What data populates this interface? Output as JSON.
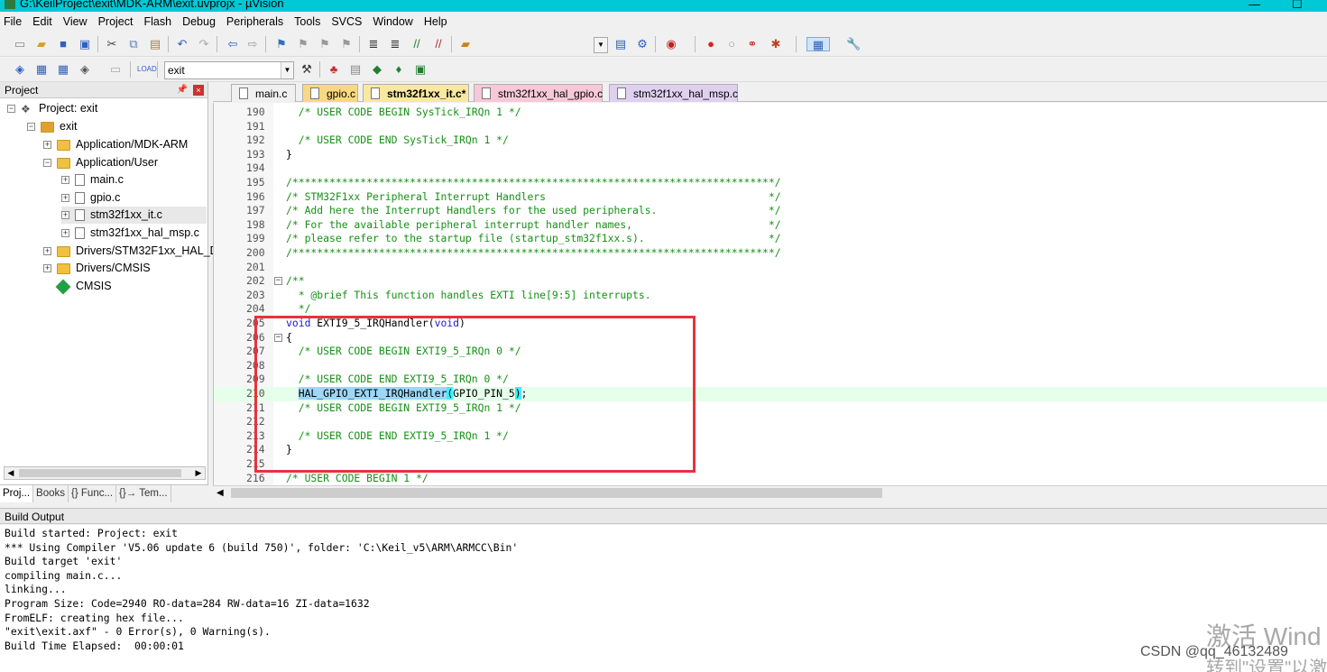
{
  "window": {
    "title": "G:\\KeilProject\\exit\\MDK-ARM\\exit.uvprojx - µVision"
  },
  "menu": [
    "File",
    "Edit",
    "View",
    "Project",
    "Flash",
    "Debug",
    "Peripherals",
    "Tools",
    "SVCS",
    "Window",
    "Help"
  ],
  "toolbar": {
    "target": "exit"
  },
  "project_panel": {
    "title": "Project",
    "tree": {
      "root": "Project: exit",
      "target": "exit",
      "group_mdk": "Application/MDK-ARM",
      "group_user": "Application/User",
      "file_main": "main.c",
      "file_gpio": "gpio.c",
      "file_it": "stm32f1xx_it.c",
      "file_msp": "stm32f1xx_hal_msp.c",
      "group_drivers_hal": "Drivers/STM32F1xx_HAL_Dr",
      "group_drivers_cmsis": "Drivers/CMSIS",
      "cmsis": "CMSIS"
    },
    "tabs": [
      "Proj...",
      "Books",
      "{} Func...",
      "{}→ Tem..."
    ]
  },
  "editor": {
    "tabs": [
      "main.c",
      "gpio.c",
      "stm32f1xx_it.c*",
      "stm32f1xx_hal_gpio.c",
      "stm32f1xx_hal_msp.c"
    ],
    "active_tab": "stm32f1xx_it.c*",
    "tab_colors": [
      "#f0f0f0",
      "#f8d880",
      "#f8e8a0",
      "#f8c8d8",
      "#e0d0f0"
    ],
    "lines": [
      {
        "n": "190",
        "t": "  /* USER CODE BEGIN SysTick_IRQn 1 */"
      },
      {
        "n": "191",
        "t": ""
      },
      {
        "n": "192",
        "t": "  /* USER CODE END SysTick_IRQn 1 */"
      },
      {
        "n": "193",
        "t": "}"
      },
      {
        "n": "194",
        "t": ""
      },
      {
        "n": "195",
        "t": "/******************************************************************************/"
      },
      {
        "n": "196",
        "t": "/* STM32F1xx Peripheral Interrupt Handlers                                    */"
      },
      {
        "n": "197",
        "t": "/* Add here the Interrupt Handlers for the used peripherals.                  */"
      },
      {
        "n": "198",
        "t": "/* For the available peripheral interrupt handler names,                      */"
      },
      {
        "n": "199",
        "t": "/* please refer to the startup file (startup_stm32f1xx.s).                    */"
      },
      {
        "n": "200",
        "t": "/******************************************************************************/"
      },
      {
        "n": "201",
        "t": ""
      },
      {
        "n": "202",
        "t": "/**"
      },
      {
        "n": "203",
        "t": "  * @brief This function handles EXTI line[9:5] interrupts."
      },
      {
        "n": "204",
        "t": "  */"
      },
      {
        "n": "205",
        "t": "void EXTI9_5_IRQHandler(void)"
      },
      {
        "n": "206",
        "t": "{"
      },
      {
        "n": "207",
        "t": "  /* USER CODE BEGIN EXTI9_5_IRQn 0 */"
      },
      {
        "n": "208",
        "t": ""
      },
      {
        "n": "209",
        "t": "  /* USER CODE END EXTI9_5_IRQn 0 */"
      },
      {
        "n": "210",
        "t": "  HAL_GPIO_EXTI_IRQHandler(GPIO_PIN_5);"
      },
      {
        "n": "211",
        "t": "  /* USER CODE BEGIN EXTI9_5_IRQn 1 */"
      },
      {
        "n": "212",
        "t": ""
      },
      {
        "n": "213",
        "t": "  /* USER CODE END EXTI9_5_IRQn 1 */"
      },
      {
        "n": "214",
        "t": "}"
      },
      {
        "n": "215",
        "t": ""
      },
      {
        "n": "216",
        "t": "/* USER CODE BEGIN 1 */"
      }
    ],
    "line210": {
      "sel": "HAL_GPIO_EXTI_IRQHandler",
      "p1": "(",
      "arg": "GPIO_PIN_5",
      "p2": ")",
      "end": ";"
    },
    "line205": {
      "kw": "void",
      "name": " EXTI9_5_IRQHandler(",
      "kw2": "void",
      "close": ")"
    }
  },
  "build_output": {
    "title": "Build Output",
    "lines": [
      "Build started: Project: exit",
      "*** Using Compiler 'V5.06 update 6 (build 750)', folder: 'C:\\Keil_v5\\ARM\\ARMCC\\Bin'",
      "Build target 'exit'",
      "compiling main.c...",
      "linking...",
      "Program Size: Code=2940 RO-data=284 RW-data=16 ZI-data=1632",
      "FromELF: creating hex file...",
      "\"exit\\exit.axf\" - 0 Error(s), 0 Warning(s).",
      "Build Time Elapsed:  00:00:01"
    ]
  },
  "overlay": {
    "watermark1": "激活 Wind",
    "watermark2": "转到\"设置\"以激",
    "csdn": "CSDN @qq_46132489"
  }
}
